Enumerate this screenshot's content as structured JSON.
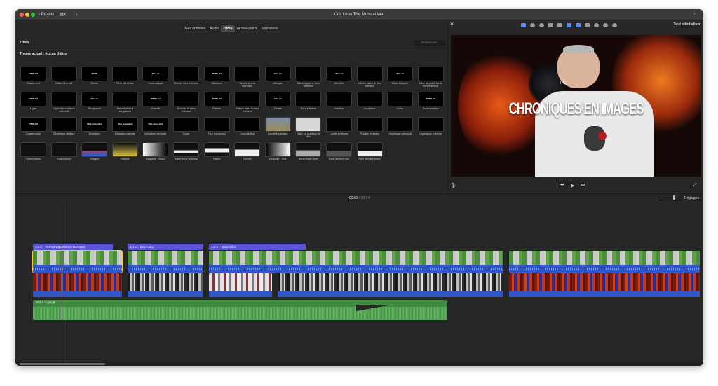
{
  "titlebar": {
    "back_label": "Projets",
    "title": "Cris Luna The Musical War"
  },
  "browser": {
    "tabs": [
      "Mes données",
      "Audio",
      "Titres",
      "Arrière-plans",
      "Transitions"
    ],
    "active_tab": "Titres",
    "section_title": "Titres",
    "search_placeholder": "Rechercher",
    "theme_label": "Thème actuel : Aucun thème",
    "titles": [
      {
        "label": "Glissement",
        "thumb": "TITRE ICI"
      },
      {
        "label": "Gliss. tiers inf.",
        "thumb": ""
      },
      {
        "label": "Divisé",
        "thumb": "TITRE"
      },
      {
        "label": "Tiers inf. divisé",
        "thumb": ""
      },
      {
        "label": "Chromatique",
        "thumb": "Titre ici"
      },
      {
        "label": "Chrom. tiers inférieur",
        "thumb": ""
      },
      {
        "label": "Standard",
        "thumb": "TITRE ICI"
      },
      {
        "label": "Tiers inférieur standard",
        "thumb": ""
      },
      {
        "label": "Allonger",
        "thumb": "Titre ici"
      },
      {
        "label": "Développer le tiers inférieur",
        "thumb": ""
      },
      {
        "label": "Dévoiler",
        "thumb": "Titre ici"
      },
      {
        "label": "Afficher dans le tiers inférieur",
        "thumb": ""
      },
      {
        "label": "Mise au point",
        "thumb": "Titre ici"
      },
      {
        "label": "Mise au point sur le tiers inférieur",
        "thumb": ""
      },
      {
        "label": "Ligne",
        "thumb": "TITRE ICI"
      },
      {
        "label": "Ligne dans le tiers inférieur",
        "thumb": ""
      },
      {
        "label": "Surgissant",
        "thumb": "Titre ici"
      },
      {
        "label": "Tiers inférieur surgissant",
        "thumb": ""
      },
      {
        "label": "Gravité",
        "thumb": "TITRE ICI"
      },
      {
        "label": "Gravité du tiers inférieur",
        "thumb": ""
      },
      {
        "label": "Prisme",
        "thumb": "TITRE ICI"
      },
      {
        "label": "Prisme dans le tiers inférieur",
        "thumb": ""
      },
      {
        "label": "Centré",
        "thumb": "Titre ici"
      },
      {
        "label": "Tiers inférieur",
        "thumb": ""
      },
      {
        "label": "Inférieur",
        "thumb": ""
      },
      {
        "label": "Supérieur",
        "thumb": ""
      },
      {
        "label": "Écho",
        "thumb": ""
      },
      {
        "label": "Superposition",
        "thumb": "TITRE ICI"
      },
      {
        "label": "Quatre coins",
        "thumb": "TITRE ICI"
      },
      {
        "label": "Générique défilant",
        "thumb": ""
      },
      {
        "label": "Déviation",
        "thumb": "Titre Sous-titre"
      },
      {
        "label": "Déviation latérale",
        "thumb": "Titre Sous-titre"
      },
      {
        "label": "Déviation verticale",
        "thumb": "Titre Sous-titre"
      },
      {
        "label": "Zoom",
        "thumb": ""
      },
      {
        "label": "Flou horizontal",
        "thumb": ""
      },
      {
        "label": "Contour flou",
        "thumb": ""
      },
      {
        "label": "Lumière parasite",
        "thumb": ""
      },
      {
        "label": "Mise au point sur le titre",
        "thumb": ""
      },
      {
        "label": "Lumières floues",
        "thumb": ""
      },
      {
        "label": "Poudre d'étoiles",
        "thumb": ""
      },
      {
        "label": "Organique principal",
        "thumb": ""
      },
      {
        "label": "Organique inférieur",
        "thumb": ""
      },
      {
        "label": "Téléscripteur",
        "thumb": ""
      },
      {
        "label": "Dateylouvre",
        "thumb": ""
      },
      {
        "label": "Nuages",
        "thumb": ""
      },
      {
        "label": "Galaxie",
        "thumb": ""
      },
      {
        "label": "Dégradé - Blanc",
        "thumb": ""
      },
      {
        "label": "Barre floue blanche",
        "thumb": ""
      },
      {
        "label": "Papier",
        "thumb": ""
      },
      {
        "label": "Formel",
        "thumb": ""
      },
      {
        "label": "Dégradé - Noir",
        "thumb": ""
      },
      {
        "label": "Barre floue noire",
        "thumb": ""
      },
      {
        "label": "Bord déchiré noir",
        "thumb": ""
      },
      {
        "label": "Bord déchiré blanc",
        "thumb": ""
      }
    ]
  },
  "viewer": {
    "reset_label": "Tout réinitialiser",
    "overlay_text": "CHRONIQUES EN IMAGES",
    "overlay_small": "THE"
  },
  "timeline": {
    "current_time": "00:01",
    "separator": "/",
    "total_time": "03:54",
    "settings_label": "Réglages",
    "title_clips": [
      {
        "label": "4,0 s – CHRONIQUES EN IMAGES"
      },
      {
        "label": "2,5 s – Cris Luna"
      },
      {
        "label": "4,0 s – Mastérillm"
      }
    ],
    "music_label": "15,6 s – gingle"
  },
  "colors": {
    "title_clip": "#5b55d6",
    "video_clip": "#3f8a3f",
    "audio": "#2f55c8",
    "selection": "#f3c13a"
  }
}
